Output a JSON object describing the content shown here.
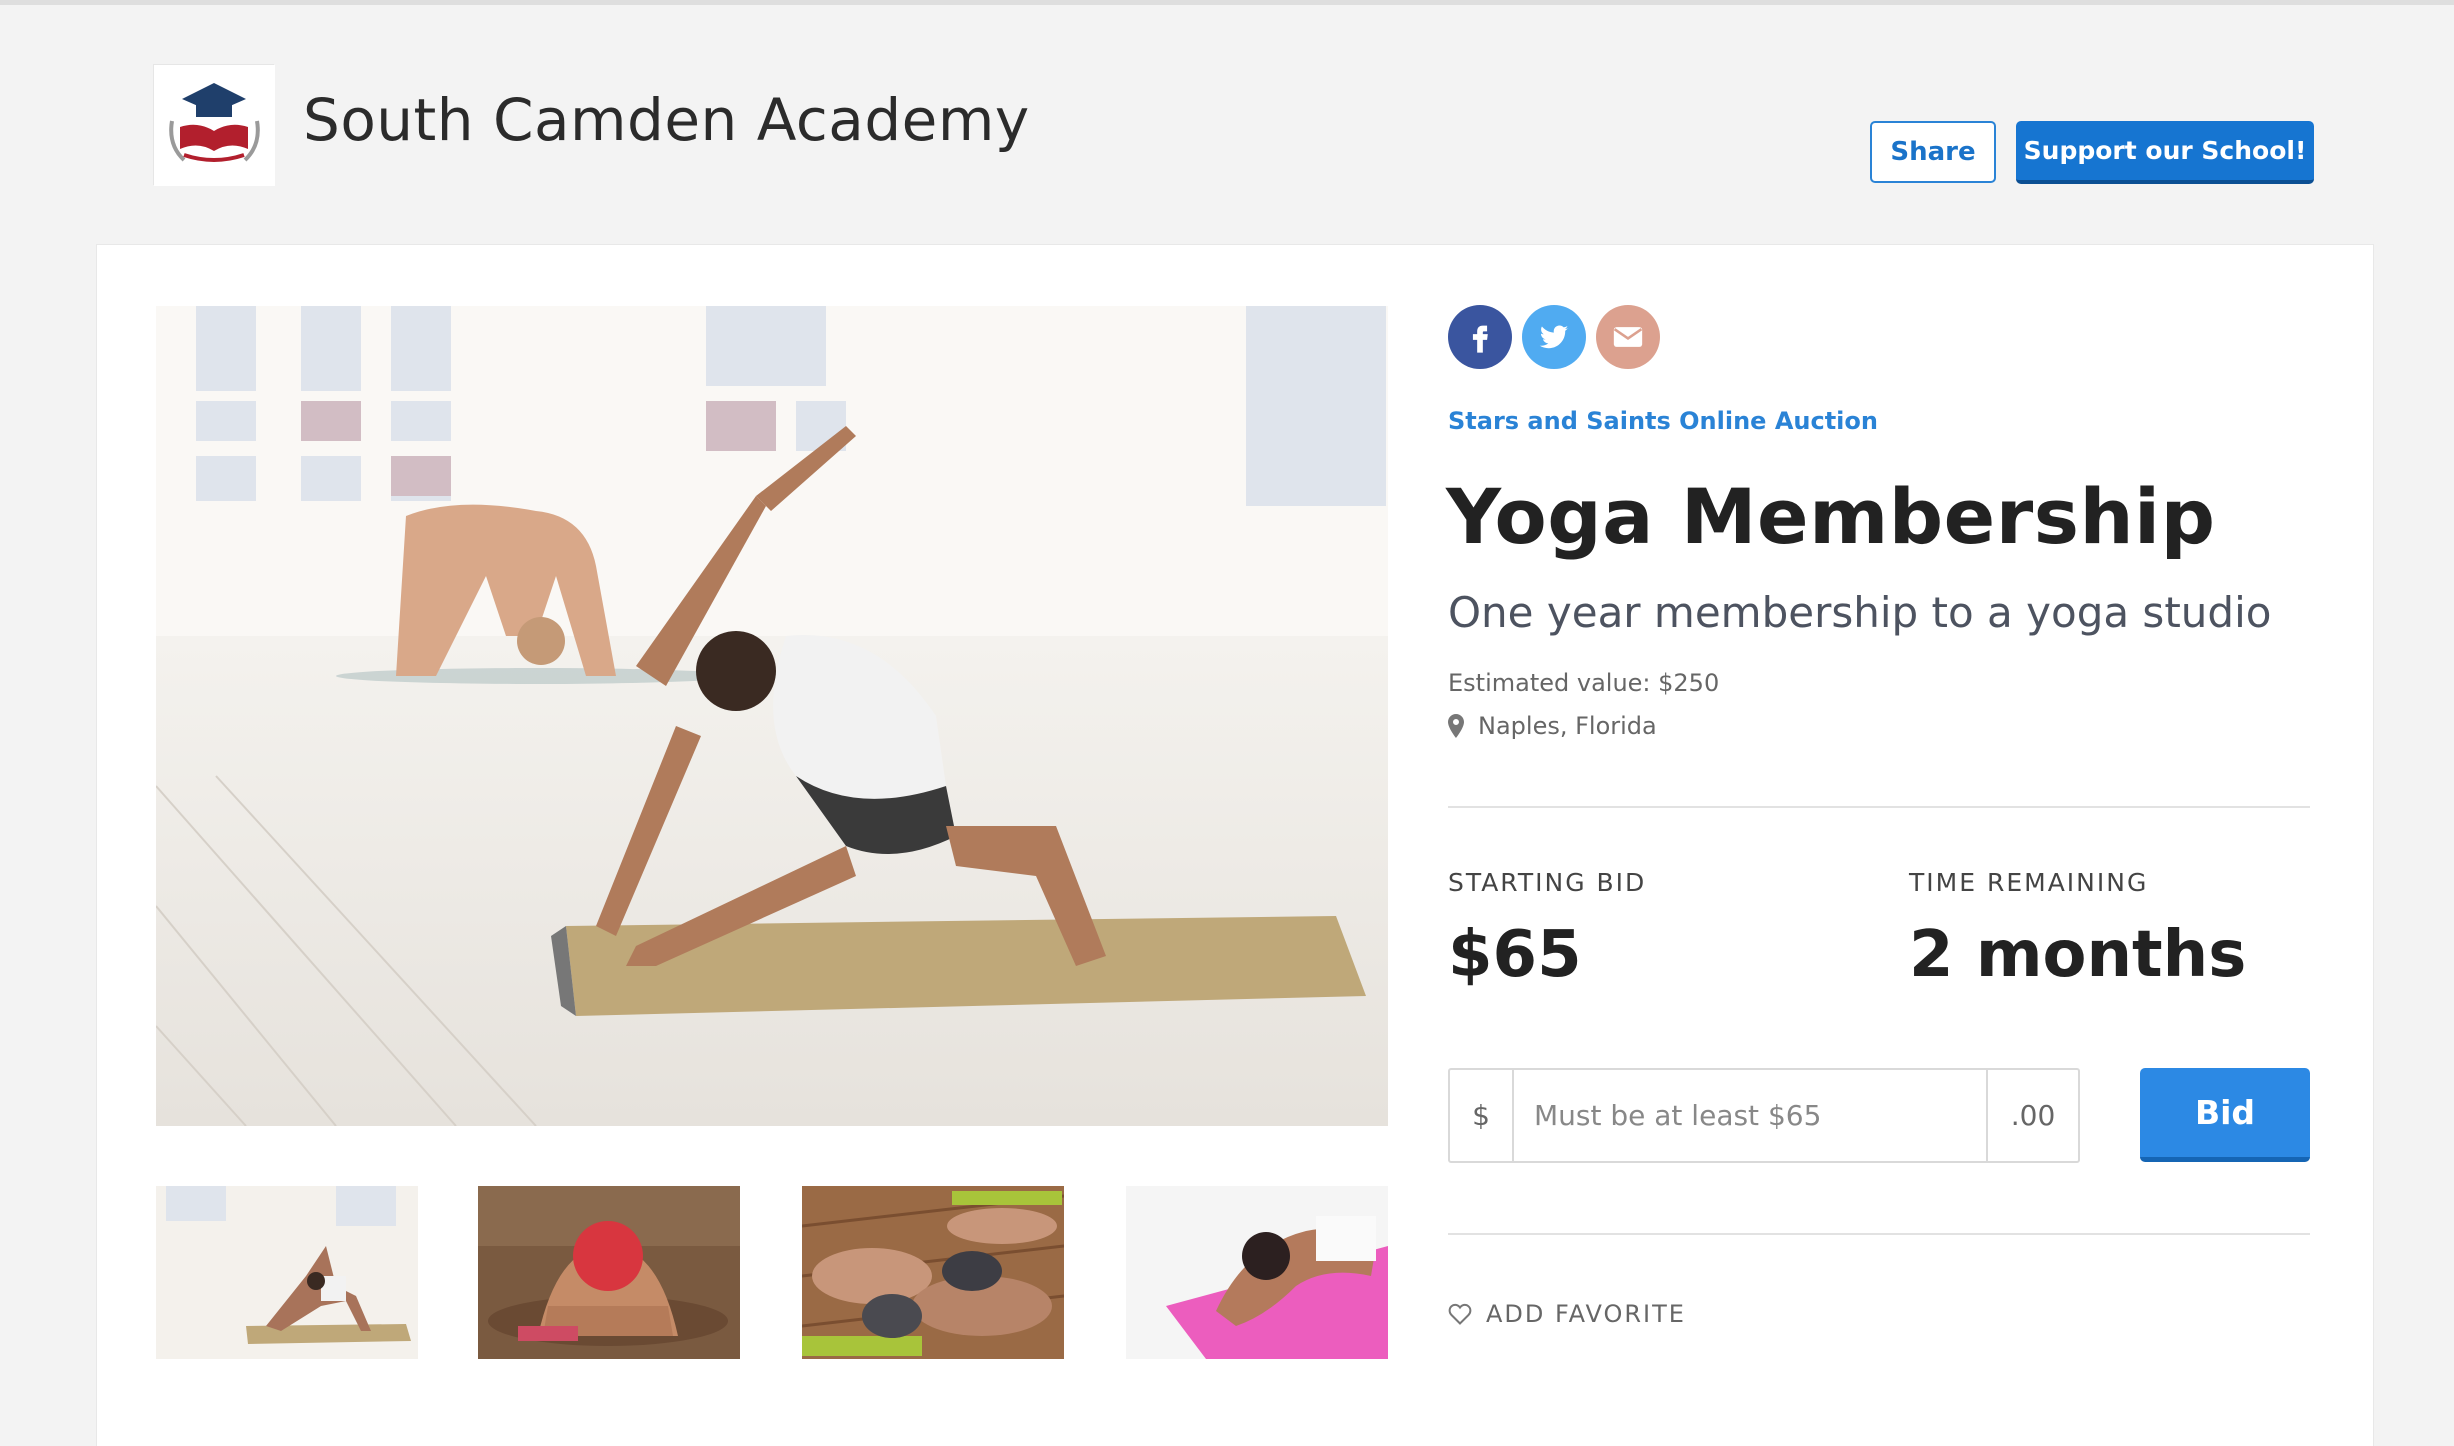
{
  "header": {
    "school_name": "South Camden Academy",
    "share_label": "Share",
    "support_label": "Support our School!"
  },
  "social": [
    "facebook-icon",
    "twitter-icon",
    "envelope-icon"
  ],
  "item": {
    "auction_name": "Stars and Saints Online Auction",
    "title": "Yoga Membership",
    "subtitle": "One year membership to a yoga studio",
    "estimated_value": "Estimated value: $250",
    "location": "Naples, Florida"
  },
  "bidding": {
    "starting_bid_label": "STARTING BID",
    "starting_bid_value": "$65",
    "time_remaining_label": "TIME REMAINING",
    "time_remaining_value": "2 months",
    "currency_prefix": "$",
    "input_placeholder": "Must be at least $65",
    "cents_suffix": ".00",
    "bid_button": "Bid"
  },
  "favorite_label": "ADD FAVORITE",
  "colors": {
    "accent": "#2c89e4",
    "support_button": "#1675d1",
    "facebook": "#3a559f",
    "twitter": "#50abf1",
    "email": "#dca18f"
  }
}
